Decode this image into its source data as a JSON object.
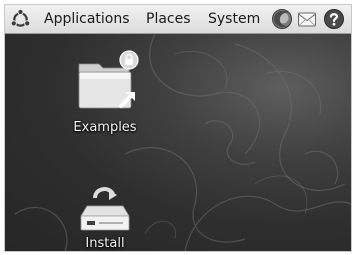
{
  "panel": {
    "menus": {
      "applications": "Applications",
      "places": "Places",
      "system": "System"
    },
    "icons": {
      "logo": "ubuntu-logo-icon",
      "browser": "firefox-browser-icon",
      "mail": "mail-icon",
      "help": "help-icon"
    }
  },
  "desktop": {
    "icons": [
      {
        "label": "Examples",
        "icon": "folder-icon",
        "badge": "lock-icon",
        "emblem": "symlink-arrow-icon"
      },
      {
        "label": "Install",
        "icon": "install-drive-icon"
      }
    ]
  },
  "colors": {
    "panel_bg": "#e4e4e4",
    "desktop_bg": "#2e2e2e"
  }
}
